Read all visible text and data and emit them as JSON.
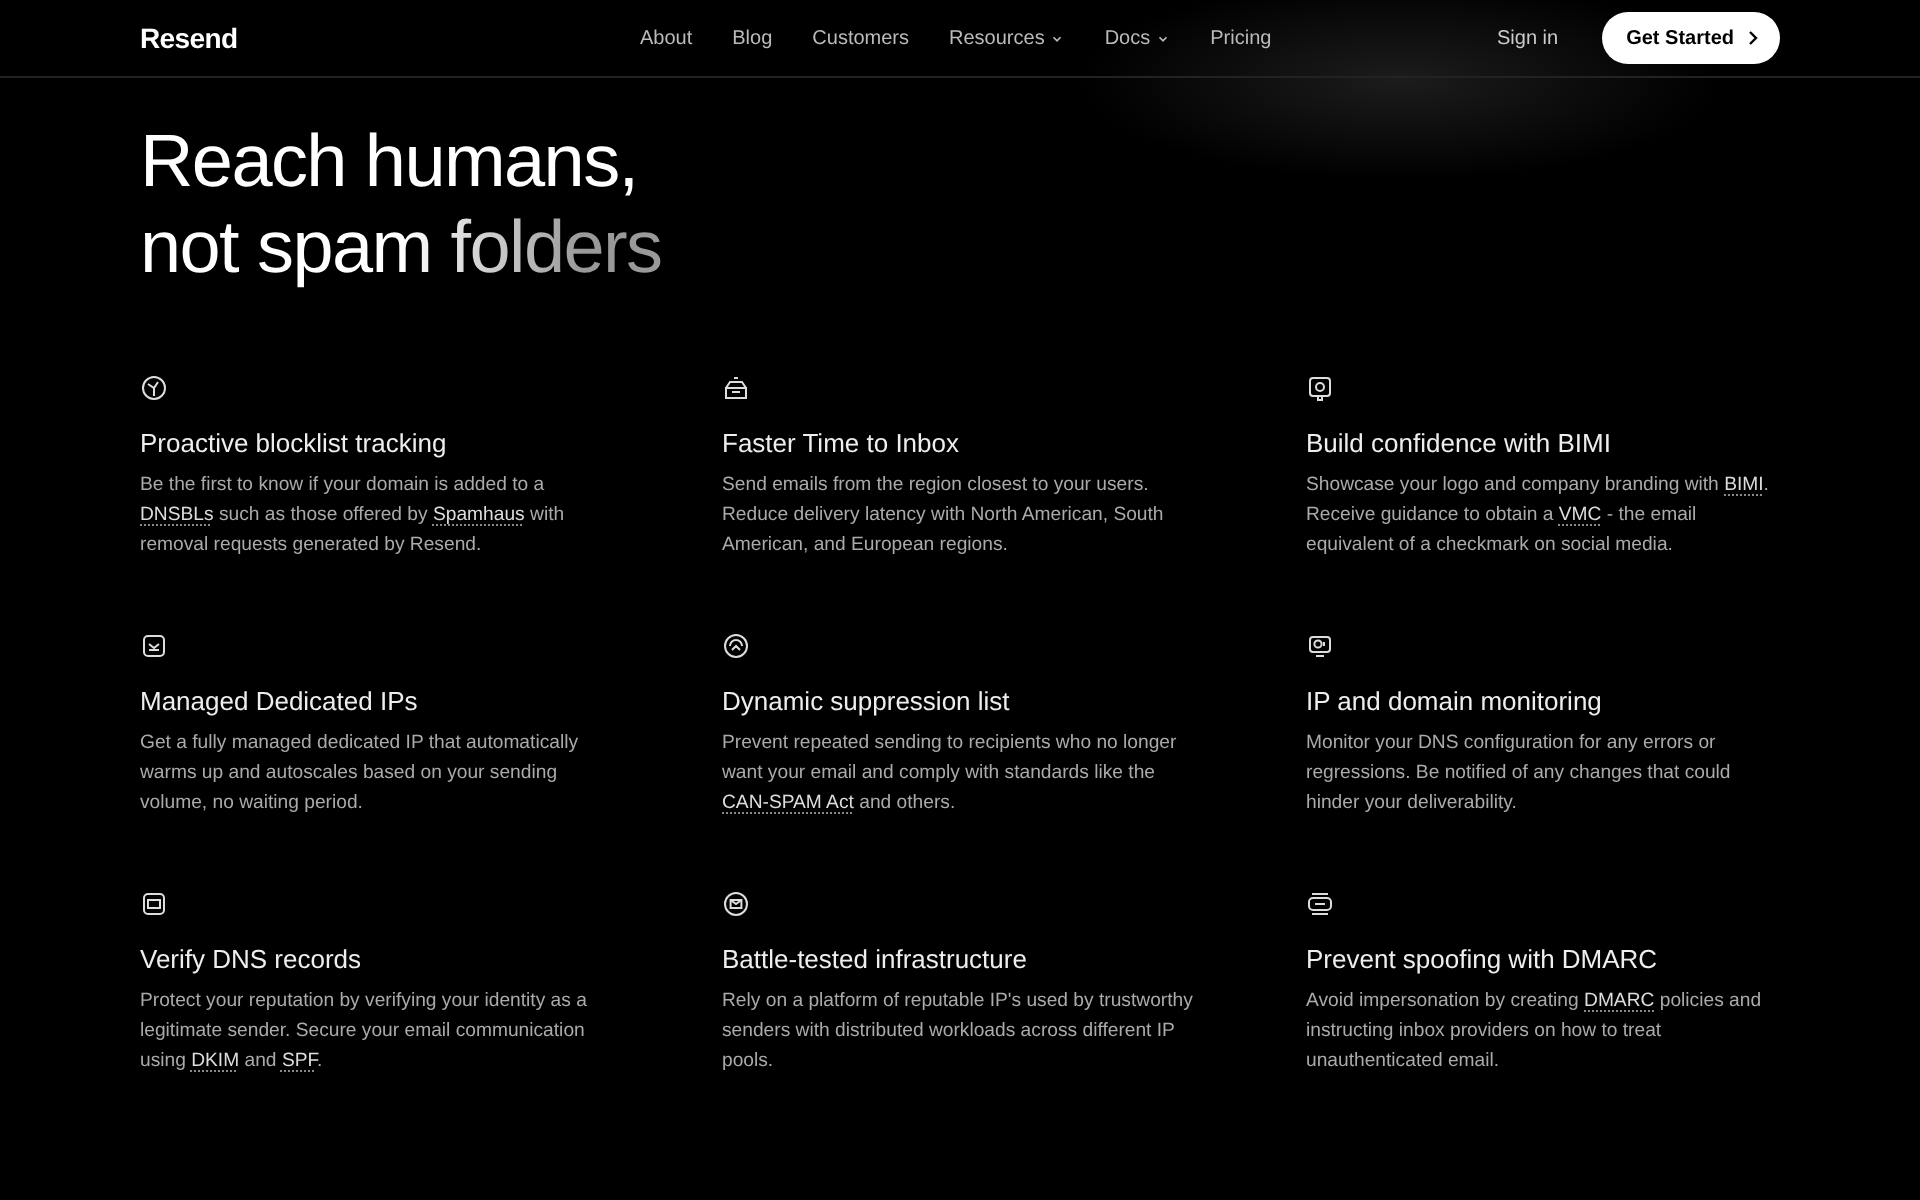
{
  "header": {
    "logo": "Resend",
    "nav": [
      {
        "label": "About",
        "dropdown": false
      },
      {
        "label": "Blog",
        "dropdown": false
      },
      {
        "label": "Customers",
        "dropdown": false
      },
      {
        "label": "Resources",
        "dropdown": true
      },
      {
        "label": "Docs",
        "dropdown": true
      },
      {
        "label": "Pricing",
        "dropdown": false
      }
    ],
    "sign_in": "Sign in",
    "cta": "Get Started"
  },
  "hero": {
    "lines": [
      "Reach humans,",
      "not spam folders"
    ]
  },
  "features": [
    {
      "title": "Proactive blocklist tracking",
      "description": [
        {
          "text": "Be the first to know if your domain is added to a ",
          "link": false
        },
        {
          "text": "DNSBLs",
          "link": true
        },
        {
          "text": " such as those offered by ",
          "link": false
        },
        {
          "text": "Spamhaus",
          "link": true
        },
        {
          "text": " with removal requests generated by Resend.",
          "link": false
        }
      ]
    },
    {
      "title": "Faster Time to Inbox",
      "description": [
        {
          "text": "Send emails from the region closest to your users. Reduce delivery latency with North American, South American, and European regions.",
          "link": false
        }
      ]
    },
    {
      "title": "Build confidence with BIMI",
      "description": [
        {
          "text": "Showcase your logo and company branding with ",
          "link": false
        },
        {
          "text": "BIMI",
          "link": true
        },
        {
          "text": ". Receive guidance to obtain a ",
          "link": false
        },
        {
          "text": "VMC",
          "link": true
        },
        {
          "text": " - the email equivalent of a checkmark on social media.",
          "link": false
        }
      ]
    },
    {
      "title": "Managed Dedicated IPs",
      "description": [
        {
          "text": "Get a fully managed dedicated IP that automatically warms up and autoscales based on your sending volume, no waiting period.",
          "link": false
        }
      ]
    },
    {
      "title": "Dynamic suppression list",
      "description": [
        {
          "text": "Prevent repeated sending to recipients who no longer want your email and comply with standards like the ",
          "link": false
        },
        {
          "text": "CAN-SPAM Act",
          "link": true
        },
        {
          "text": " and others.",
          "link": false
        }
      ]
    },
    {
      "title": "IP and domain monitoring",
      "description": [
        {
          "text": "Monitor your DNS configuration for any errors or regressions. Be notified of any changes that could hinder your deliverability.",
          "link": false
        }
      ]
    },
    {
      "title": "Verify DNS records",
      "description": [
        {
          "text": "Protect your reputation by verifying your identity as a legitimate sender. Secure your email communication using ",
          "link": false
        },
        {
          "text": "DKIM",
          "link": true
        },
        {
          "text": " and ",
          "link": false
        },
        {
          "text": "SPF",
          "link": true
        },
        {
          "text": ".",
          "link": false
        }
      ]
    },
    {
      "title": "Battle-tested infrastructure",
      "description": [
        {
          "text": "Rely on a platform of reputable IP's used by trustworthy senders with distributed workloads across different IP pools.",
          "link": false
        }
      ]
    },
    {
      "title": "Prevent spoofing with DMARC",
      "description": [
        {
          "text": "Avoid impersonation by creating ",
          "link": false
        },
        {
          "text": "DMARC",
          "link": true
        },
        {
          "text": " policies and instructing inbox providers on how to treat unauthenticated email.",
          "link": false
        }
      ]
    }
  ]
}
